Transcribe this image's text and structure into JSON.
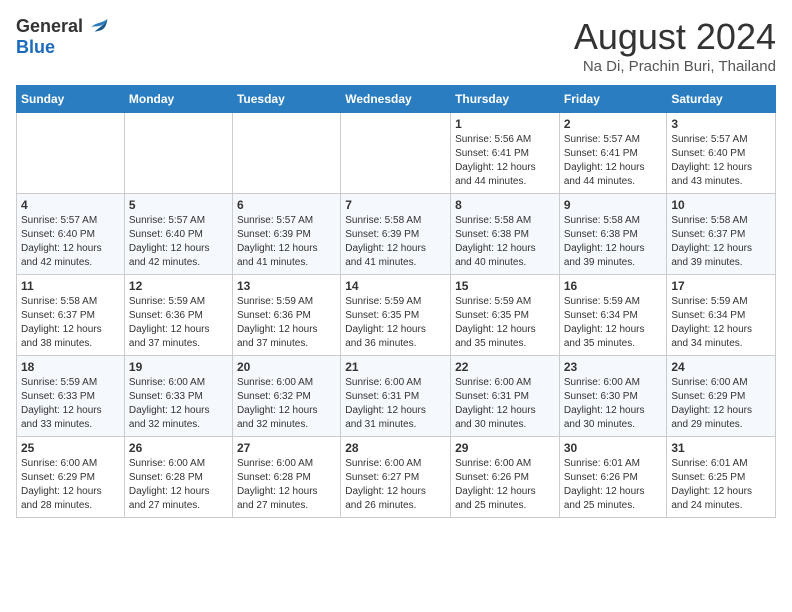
{
  "logo": {
    "general": "General",
    "blue": "Blue"
  },
  "title": "August 2024",
  "subtitle": "Na Di, Prachin Buri, Thailand",
  "days_of_week": [
    "Sunday",
    "Monday",
    "Tuesday",
    "Wednesday",
    "Thursday",
    "Friday",
    "Saturday"
  ],
  "weeks": [
    [
      {
        "day": "",
        "info": ""
      },
      {
        "day": "",
        "info": ""
      },
      {
        "day": "",
        "info": ""
      },
      {
        "day": "",
        "info": ""
      },
      {
        "day": "1",
        "info": "Sunrise: 5:56 AM\nSunset: 6:41 PM\nDaylight: 12 hours\nand 44 minutes."
      },
      {
        "day": "2",
        "info": "Sunrise: 5:57 AM\nSunset: 6:41 PM\nDaylight: 12 hours\nand 44 minutes."
      },
      {
        "day": "3",
        "info": "Sunrise: 5:57 AM\nSunset: 6:40 PM\nDaylight: 12 hours\nand 43 minutes."
      }
    ],
    [
      {
        "day": "4",
        "info": "Sunrise: 5:57 AM\nSunset: 6:40 PM\nDaylight: 12 hours\nand 42 minutes."
      },
      {
        "day": "5",
        "info": "Sunrise: 5:57 AM\nSunset: 6:40 PM\nDaylight: 12 hours\nand 42 minutes."
      },
      {
        "day": "6",
        "info": "Sunrise: 5:57 AM\nSunset: 6:39 PM\nDaylight: 12 hours\nand 41 minutes."
      },
      {
        "day": "7",
        "info": "Sunrise: 5:58 AM\nSunset: 6:39 PM\nDaylight: 12 hours\nand 41 minutes."
      },
      {
        "day": "8",
        "info": "Sunrise: 5:58 AM\nSunset: 6:38 PM\nDaylight: 12 hours\nand 40 minutes."
      },
      {
        "day": "9",
        "info": "Sunrise: 5:58 AM\nSunset: 6:38 PM\nDaylight: 12 hours\nand 39 minutes."
      },
      {
        "day": "10",
        "info": "Sunrise: 5:58 AM\nSunset: 6:37 PM\nDaylight: 12 hours\nand 39 minutes."
      }
    ],
    [
      {
        "day": "11",
        "info": "Sunrise: 5:58 AM\nSunset: 6:37 PM\nDaylight: 12 hours\nand 38 minutes."
      },
      {
        "day": "12",
        "info": "Sunrise: 5:59 AM\nSunset: 6:36 PM\nDaylight: 12 hours\nand 37 minutes."
      },
      {
        "day": "13",
        "info": "Sunrise: 5:59 AM\nSunset: 6:36 PM\nDaylight: 12 hours\nand 37 minutes."
      },
      {
        "day": "14",
        "info": "Sunrise: 5:59 AM\nSunset: 6:35 PM\nDaylight: 12 hours\nand 36 minutes."
      },
      {
        "day": "15",
        "info": "Sunrise: 5:59 AM\nSunset: 6:35 PM\nDaylight: 12 hours\nand 35 minutes."
      },
      {
        "day": "16",
        "info": "Sunrise: 5:59 AM\nSunset: 6:34 PM\nDaylight: 12 hours\nand 35 minutes."
      },
      {
        "day": "17",
        "info": "Sunrise: 5:59 AM\nSunset: 6:34 PM\nDaylight: 12 hours\nand 34 minutes."
      }
    ],
    [
      {
        "day": "18",
        "info": "Sunrise: 5:59 AM\nSunset: 6:33 PM\nDaylight: 12 hours\nand 33 minutes."
      },
      {
        "day": "19",
        "info": "Sunrise: 6:00 AM\nSunset: 6:33 PM\nDaylight: 12 hours\nand 32 minutes."
      },
      {
        "day": "20",
        "info": "Sunrise: 6:00 AM\nSunset: 6:32 PM\nDaylight: 12 hours\nand 32 minutes."
      },
      {
        "day": "21",
        "info": "Sunrise: 6:00 AM\nSunset: 6:31 PM\nDaylight: 12 hours\nand 31 minutes."
      },
      {
        "day": "22",
        "info": "Sunrise: 6:00 AM\nSunset: 6:31 PM\nDaylight: 12 hours\nand 30 minutes."
      },
      {
        "day": "23",
        "info": "Sunrise: 6:00 AM\nSunset: 6:30 PM\nDaylight: 12 hours\nand 30 minutes."
      },
      {
        "day": "24",
        "info": "Sunrise: 6:00 AM\nSunset: 6:29 PM\nDaylight: 12 hours\nand 29 minutes."
      }
    ],
    [
      {
        "day": "25",
        "info": "Sunrise: 6:00 AM\nSunset: 6:29 PM\nDaylight: 12 hours\nand 28 minutes."
      },
      {
        "day": "26",
        "info": "Sunrise: 6:00 AM\nSunset: 6:28 PM\nDaylight: 12 hours\nand 27 minutes."
      },
      {
        "day": "27",
        "info": "Sunrise: 6:00 AM\nSunset: 6:28 PM\nDaylight: 12 hours\nand 27 minutes."
      },
      {
        "day": "28",
        "info": "Sunrise: 6:00 AM\nSunset: 6:27 PM\nDaylight: 12 hours\nand 26 minutes."
      },
      {
        "day": "29",
        "info": "Sunrise: 6:00 AM\nSunset: 6:26 PM\nDaylight: 12 hours\nand 25 minutes."
      },
      {
        "day": "30",
        "info": "Sunrise: 6:01 AM\nSunset: 6:26 PM\nDaylight: 12 hours\nand 25 minutes."
      },
      {
        "day": "31",
        "info": "Sunrise: 6:01 AM\nSunset: 6:25 PM\nDaylight: 12 hours\nand 24 minutes."
      }
    ]
  ]
}
